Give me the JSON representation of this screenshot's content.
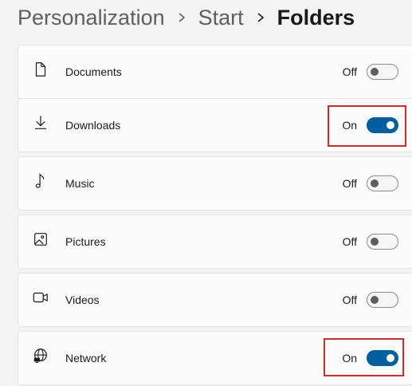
{
  "breadcrumb": {
    "items": [
      "Personalization",
      "Start",
      "Folders"
    ]
  },
  "folders": [
    {
      "label": "Documents",
      "icon": "document-icon",
      "state": "Off",
      "on": false
    },
    {
      "label": "Downloads",
      "icon": "download-icon",
      "state": "On",
      "on": true
    },
    {
      "label": "Music",
      "icon": "music-icon",
      "state": "Off",
      "on": false
    },
    {
      "label": "Pictures",
      "icon": "pictures-icon",
      "state": "Off",
      "on": false
    },
    {
      "label": "Videos",
      "icon": "video-icon",
      "state": "Off",
      "on": false
    },
    {
      "label": "Network",
      "icon": "network-icon",
      "state": "On",
      "on": true
    }
  ],
  "colors": {
    "accent": "#005fa0",
    "highlight": "#d42a2a",
    "background": "#f3f3f3",
    "card": "#fbfbfb"
  }
}
